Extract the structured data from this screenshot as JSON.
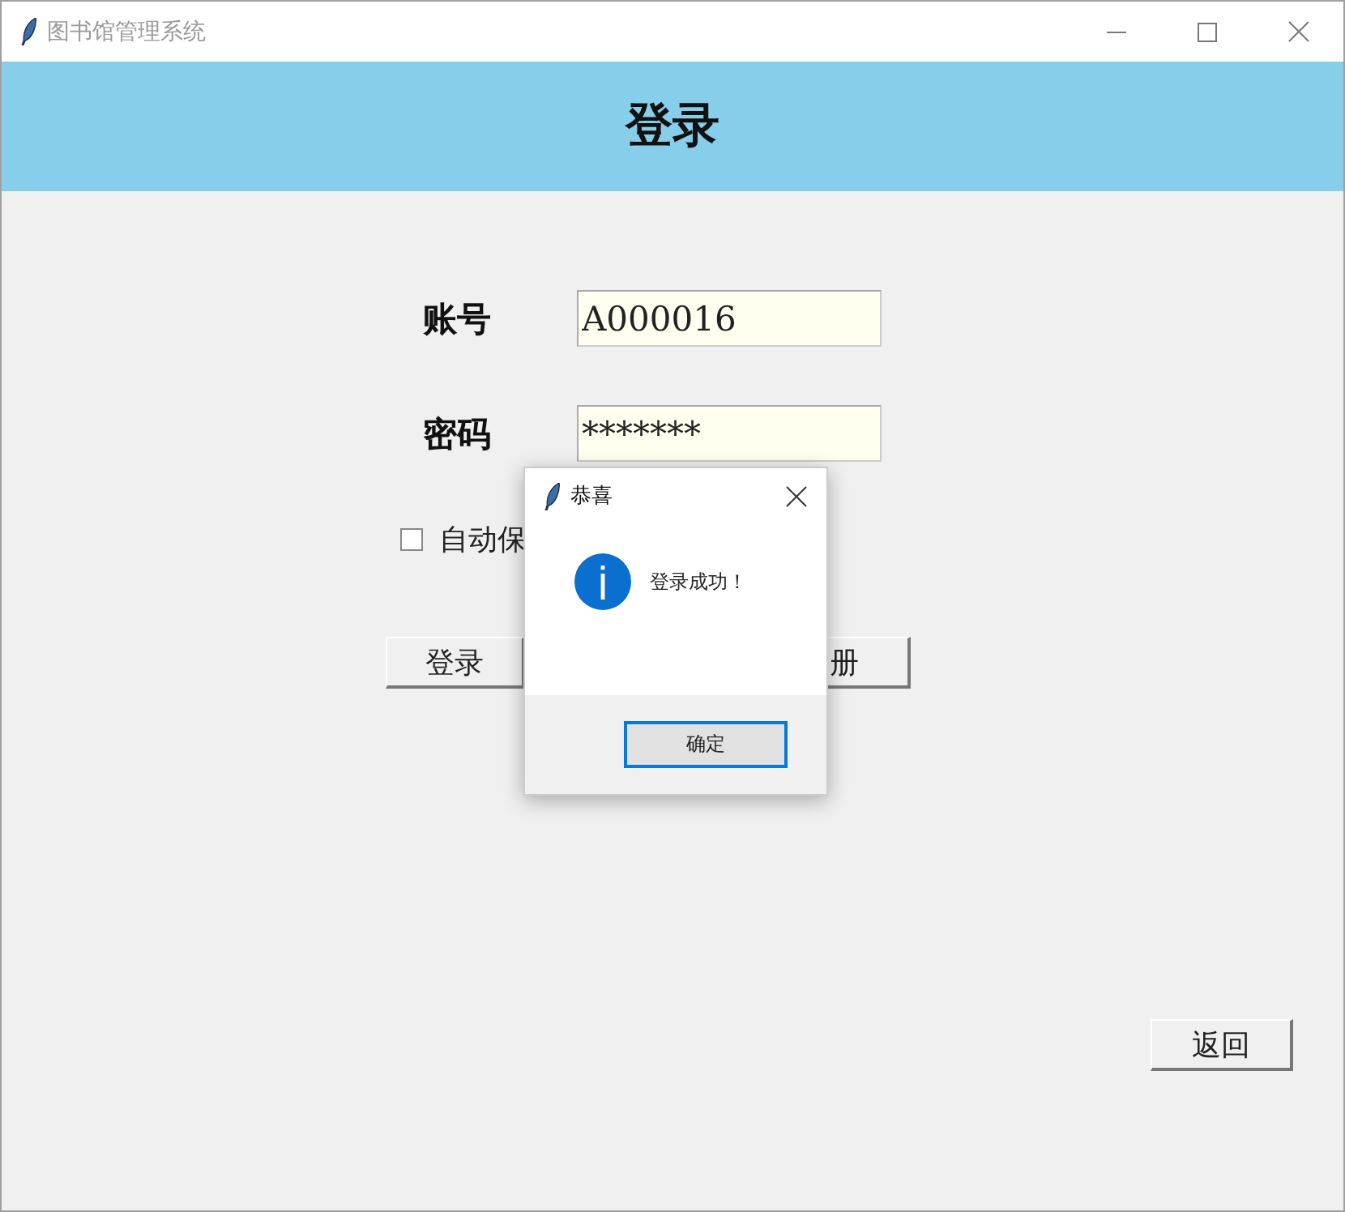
{
  "window": {
    "title": "图书馆管理系统"
  },
  "header": {
    "title": "登录"
  },
  "form": {
    "fields": [
      {
        "label": "账号",
        "value": "A000016"
      },
      {
        "label": "密码",
        "value": "*******"
      }
    ],
    "auto_save": {
      "label": "自动保",
      "checked": false
    },
    "buttons": [
      {
        "label": "登录"
      },
      {
        "label": "册"
      }
    ]
  },
  "back_button": {
    "label": "返回"
  },
  "dialog": {
    "title": "恭喜",
    "message": "登录成功！",
    "button": "确定"
  }
}
